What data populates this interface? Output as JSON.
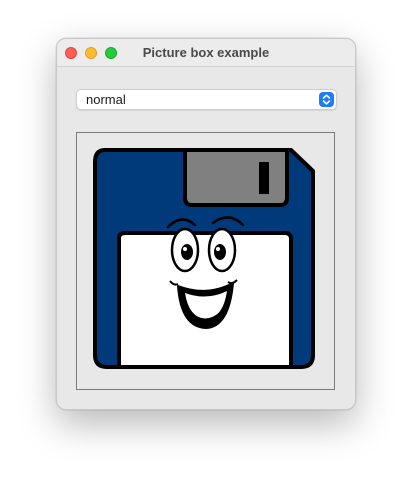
{
  "window": {
    "title": "Picture box example"
  },
  "size_mode_select": {
    "value": "normal",
    "icon": "chevron-up-down-icon"
  },
  "picture_box": {
    "image": "floppy-disk-smiley",
    "colors": {
      "disk_body": "#003a7a",
      "shutter": "#808080",
      "label": "#ffffff"
    }
  },
  "colors": {
    "close": "#ff5f57",
    "minimize": "#febc2e",
    "maximize": "#28c840",
    "accent": "#1f7cf7"
  }
}
